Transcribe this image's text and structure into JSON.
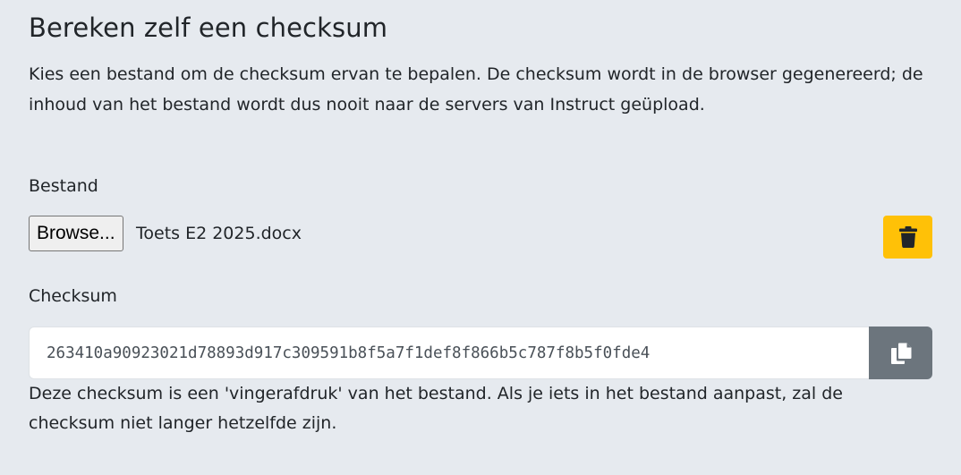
{
  "section": {
    "title": "Bereken zelf een checksum",
    "intro": "Kies een bestand om de checksum ervan te bepalen. De checksum wordt in de browser gegenereerd; de inhoud van het bestand wordt dus nooit naar de servers van Instruct geüpload."
  },
  "file": {
    "label": "Bestand",
    "browse_label": "Browse...",
    "selected_file": "Toets E2 2025.docx",
    "delete_icon": "trash-icon",
    "delete_color": "#ffc107"
  },
  "checksum": {
    "label": "Checksum",
    "value": "263410a90923021d78893d917c309591b8f5a7f1def8f866b5c787f8b5f0fde4",
    "copy_icon": "copy-icon",
    "copy_color": "#6c757d",
    "help": "Deze checksum is een 'vingerafdruk' van het bestand. Als je iets in het bestand aanpast, zal de checksum niet langer hetzelfde zijn."
  }
}
